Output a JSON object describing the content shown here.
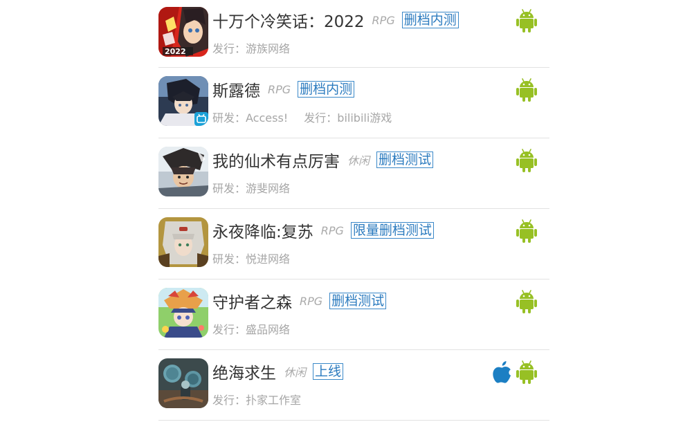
{
  "colors": {
    "tag_blue": "#2b7bbf",
    "android_green": "#97c024",
    "apple_blue": "#1c7fc3",
    "meta_gray": "#a6a6a6",
    "title_dark": "#333333"
  },
  "games": [
    {
      "title": "十万个冷笑话：2022",
      "genre": "RPG",
      "tag": "删档内测",
      "meta": [
        "发行：游族网络"
      ],
      "platforms": [
        "android-icon"
      ],
      "icon": "game-icon-shiwange"
    },
    {
      "title": "斯露德",
      "genre": "RPG",
      "tag": "删档内测",
      "meta": [
        "研发：Access!",
        "发行：bilibili游戏"
      ],
      "platforms": [
        "android-icon"
      ],
      "icon": "game-icon-siloude"
    },
    {
      "title": "我的仙术有点厉害",
      "genre": "休闲",
      "tag": "删档测试",
      "meta": [
        "研发：游斐网络"
      ],
      "platforms": [
        "android-icon"
      ],
      "icon": "game-icon-xianshu"
    },
    {
      "title": "永夜降临:复苏",
      "genre": "RPG",
      "tag": "限量删档测试",
      "meta": [
        "研发：悦进网络"
      ],
      "platforms": [
        "android-icon"
      ],
      "icon": "game-icon-yongye"
    },
    {
      "title": "守护者之森",
      "genre": "RPG",
      "tag": "删档测试",
      "meta": [
        "发行：盛品网络"
      ],
      "platforms": [
        "android-icon"
      ],
      "icon": "game-icon-shouhuzhe"
    },
    {
      "title": "绝海求生",
      "genre": "休闲",
      "tag": "上线",
      "meta": [
        "发行：扑家工作室"
      ],
      "platforms": [
        "apple-icon",
        "android-icon"
      ],
      "icon": "game-icon-juehai"
    }
  ]
}
